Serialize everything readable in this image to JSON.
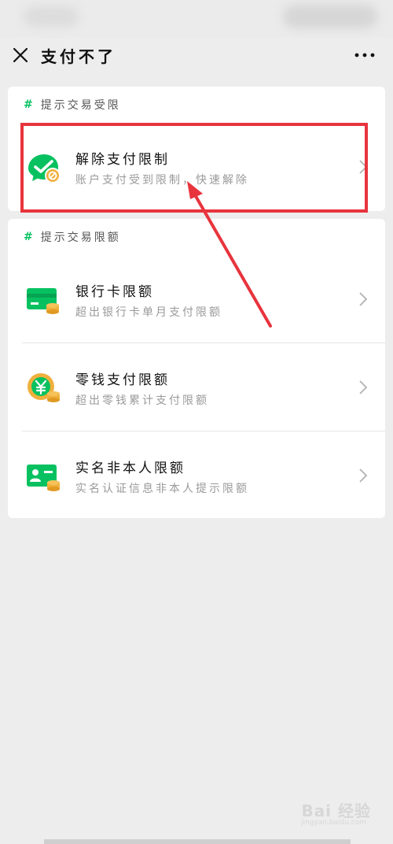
{
  "header": {
    "title": "支付不了",
    "close_icon": "close-icon",
    "more_icon": "more-icon"
  },
  "sections": [
    {
      "header": "提示交易受限",
      "items": [
        {
          "title": "解除支付限制",
          "subtitle": "账户支付受到限制，快速解除",
          "icon": "wechat-pay-blocked-icon"
        }
      ]
    },
    {
      "header": "提示交易限额",
      "items": [
        {
          "title": "银行卡限额",
          "subtitle": "超出银行卡单月支付限额",
          "icon": "bank-card-icon"
        },
        {
          "title": "零钱支付限额",
          "subtitle": "超出零钱累计支付限额",
          "icon": "change-wallet-icon"
        },
        {
          "title": "实名非本人限额",
          "subtitle": "实名认证信息非本人提示限额",
          "icon": "id-card-icon"
        }
      ]
    }
  ],
  "section_hash": "#",
  "watermark": {
    "text": "Bai 经验",
    "sub": "jingyan.baidu.com"
  },
  "colors": {
    "accent": "#07c160",
    "coin": "#f0b03c",
    "annotation": "#e8343d"
  }
}
